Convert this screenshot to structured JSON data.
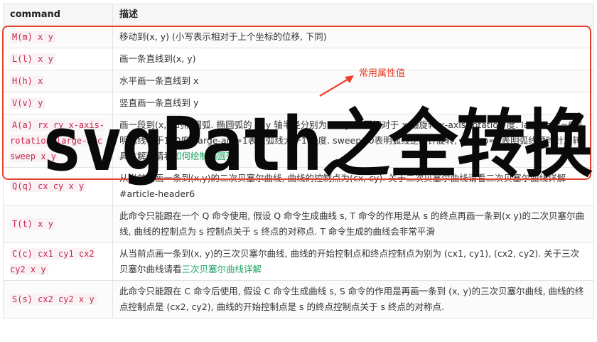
{
  "table": {
    "headers": {
      "command": "command",
      "description": "描述"
    },
    "rows": [
      {
        "cmd": "M(m) x y",
        "desc": "移动到(x, y) (小写表示相对于上个坐标的位移, 下同)",
        "link": ""
      },
      {
        "cmd": "L(l) x y",
        "desc": "画一条直线到(x, y)",
        "link": ""
      },
      {
        "cmd": "H(h) x",
        "desc": "水平画一条直线到 x",
        "link": ""
      },
      {
        "cmd": "V(v) y",
        "desc": "竖直画一条直线到 y",
        "link": ""
      },
      {
        "cmd": "A(a) rx ry x-axis-rotation large-arc sweep x y",
        "desc": "画一段到(x,y)的椭圆弧. 椭圆弧的 x, y 轴半径分别为 rx,ry. 椭圆相对于 x 轴旋转 x-axis-rotation 度. large-arc=0表明弧线小于180度, large-arc=1表示弧线大于180度. sweep=0表明弧线逆时针旋转, sweep=1表明弧线顺时针旋转. 具体解释请看",
        "link": "如何绘制椭圆弧"
      },
      {
        "cmd": "Q(q) cx cy x y",
        "desc": "从当前点画一条到(x,y)的二次贝塞尔曲线, 曲线的控制点为(cx, cy). 关于二次贝塞尔曲线请看二次贝塞尔曲线详解#article-header6",
        "link": ""
      },
      {
        "cmd": "T(t) x y",
        "desc": "此命令只能跟在一个 Q 命令使用, 假设 Q 命令生成曲线 s, T 命令的作用是从 s 的终点再画一条到(x y)的二次贝塞尔曲线, 曲线的控制点为 s 控制点关于 s 终点的对称点. T 命令生成的曲线会非常平滑",
        "link": ""
      },
      {
        "cmd": "C(c) cx1 cy1 cx2 cy2 x y",
        "desc": "从当前点画一条到(x, y)的三次贝塞尔曲线, 曲线的开始控制点和终点控制点为别为 (cx1, cy1), (cx2, cy2). 关于三次贝塞尔曲线请看",
        "link": "三次贝塞尔曲线详解"
      },
      {
        "cmd": "S(s) cx2 cy2 x y",
        "desc": "此命令只能跟在 C 命令后使用, 假设 C 命令生成曲线 s, S 命令的作用是再画一条到 (x, y)的三次贝塞尔曲线, 曲线的终点控制点是 (cx2, cy2), 曲线的开始控制点是 s 的终点控制点关于 s 终点的对称点.",
        "link": ""
      }
    ]
  },
  "annotation": {
    "label": "常用属性值",
    "color": "#e8412c"
  },
  "watermark": {
    "text": "svgPath之全转换"
  },
  "colors": {
    "code": "#c7254e",
    "link": "#1aa260",
    "highlight": "#e8412c"
  }
}
